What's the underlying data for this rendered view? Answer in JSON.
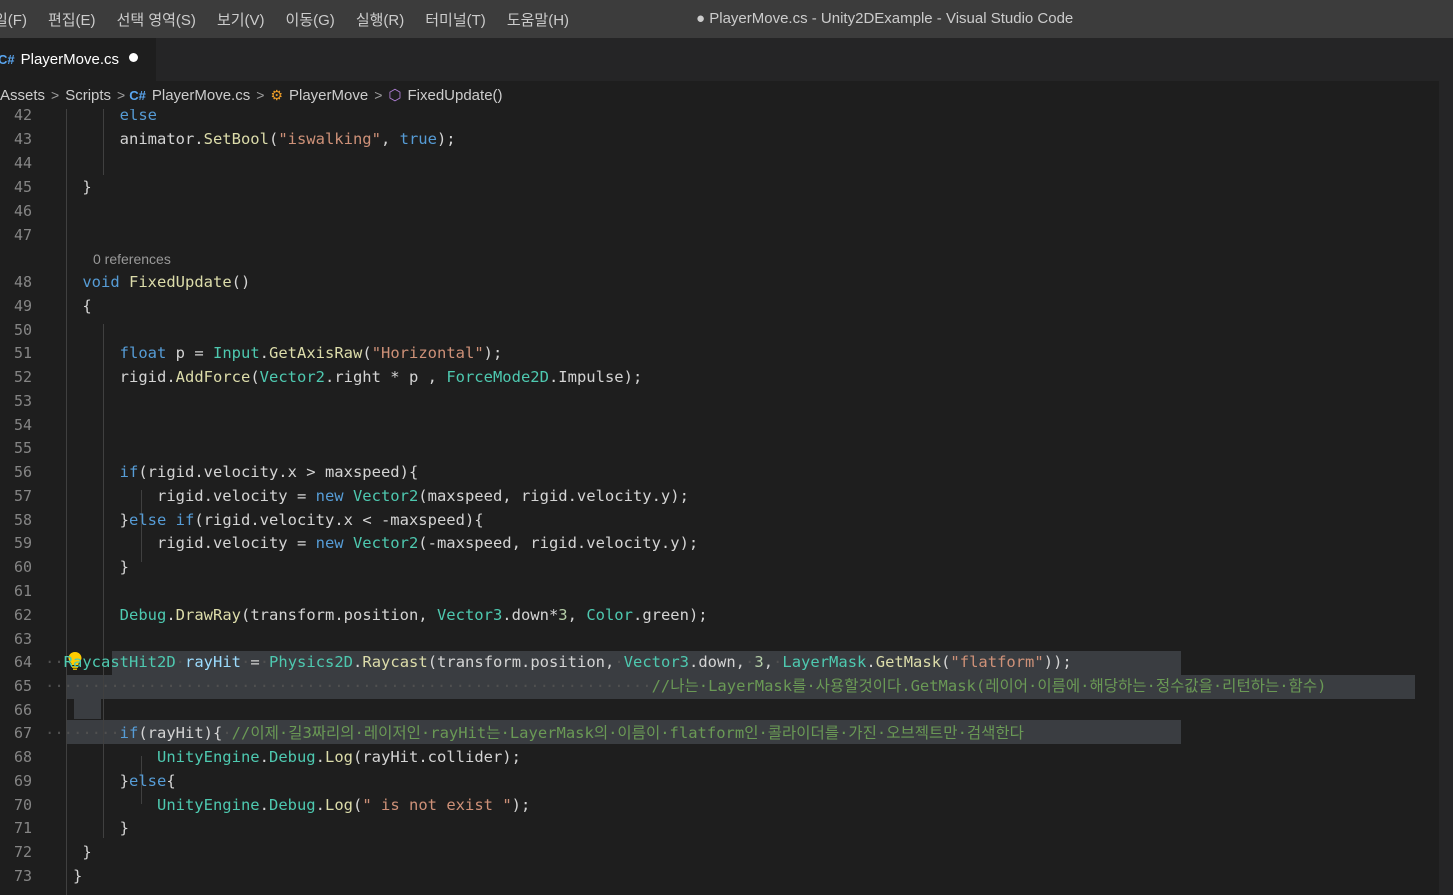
{
  "menu": [
    "일(F)",
    "편집(E)",
    "선택 영역(S)",
    "보기(V)",
    "이동(G)",
    "실행(R)",
    "터미널(T)",
    "도움말(H)"
  ],
  "window_title": "● PlayerMove.cs - Unity2DExample - Visual Studio Code",
  "tab": {
    "icon": "csharp-file-icon",
    "label": "PlayerMove.cs",
    "dirty": true
  },
  "breadcrumb": {
    "assets": "Assets",
    "scripts": "Scripts",
    "file": "PlayerMove.cs",
    "class": "PlayerMove",
    "method": "FixedUpdate()"
  },
  "codelens": "0 references",
  "colors": {
    "keyword": "#569cd6",
    "type": "#4ec9b0",
    "function": "#dcdcaa",
    "string": "#ce9178",
    "comment": "#6a9955",
    "selection": "#3a3d41",
    "background": "#1e1e1e"
  },
  "line_numbers": [
    "42",
    "43",
    "44",
    "45",
    "46",
    "47",
    "48",
    "49",
    "50",
    "51",
    "52",
    "53",
    "54",
    "55",
    "56",
    "57",
    "58",
    "59",
    "60",
    "61",
    "62",
    "63",
    "64",
    "65",
    "66",
    "67",
    "68",
    "69",
    "70",
    "71",
    "72",
    "73"
  ],
  "code_lines": [
    [
      {
        "t": "        ",
        "c": ""
      },
      {
        "t": "else",
        "c": "kw"
      }
    ],
    [
      {
        "t": "        animator.",
        "c": ""
      },
      {
        "t": "SetBool",
        "c": "fn"
      },
      {
        "t": "(",
        "c": ""
      },
      {
        "t": "\"iswalking\"",
        "c": "st"
      },
      {
        "t": ", ",
        "c": ""
      },
      {
        "t": "true",
        "c": "kw"
      },
      {
        "t": ");",
        "c": ""
      }
    ],
    [],
    [
      {
        "t": "    }",
        "c": ""
      }
    ],
    [],
    [],
    [
      {
        "t": "    ",
        "c": ""
      },
      {
        "t": "void",
        "c": "kw"
      },
      {
        "t": " ",
        "c": ""
      },
      {
        "t": "FixedUpdate",
        "c": "fn"
      },
      {
        "t": "()",
        "c": ""
      }
    ],
    [
      {
        "t": "    {",
        "c": ""
      }
    ],
    [],
    [
      {
        "t": "        ",
        "c": ""
      },
      {
        "t": "float",
        "c": "kw"
      },
      {
        "t": " p = ",
        "c": ""
      },
      {
        "t": "Input",
        "c": "ty"
      },
      {
        "t": ".",
        "c": ""
      },
      {
        "t": "GetAxisRaw",
        "c": "fn"
      },
      {
        "t": "(",
        "c": ""
      },
      {
        "t": "\"Horizontal\"",
        "c": "st"
      },
      {
        "t": ");",
        "c": ""
      }
    ],
    [
      {
        "t": "        rigid.",
        "c": ""
      },
      {
        "t": "AddForce",
        "c": "fn"
      },
      {
        "t": "(",
        "c": ""
      },
      {
        "t": "Vector2",
        "c": "ty"
      },
      {
        "t": ".right * p , ",
        "c": ""
      },
      {
        "t": "ForceMode2D",
        "c": "ty"
      },
      {
        "t": ".Impulse);",
        "c": ""
      }
    ],
    [],
    [],
    [],
    [
      {
        "t": "        ",
        "c": ""
      },
      {
        "t": "if",
        "c": "kw"
      },
      {
        "t": "(rigid.velocity.x > maxspeed){",
        "c": ""
      }
    ],
    [
      {
        "t": "            rigid.velocity = ",
        "c": ""
      },
      {
        "t": "new",
        "c": "kw"
      },
      {
        "t": " ",
        "c": ""
      },
      {
        "t": "Vector2",
        "c": "ty"
      },
      {
        "t": "(maxspeed, rigid.velocity.y);",
        "c": ""
      }
    ],
    [
      {
        "t": "        }",
        "c": ""
      },
      {
        "t": "else",
        "c": "kw"
      },
      {
        "t": " ",
        "c": ""
      },
      {
        "t": "if",
        "c": "kw"
      },
      {
        "t": "(rigid.velocity.x < -maxspeed){",
        "c": ""
      }
    ],
    [
      {
        "t": "            rigid.velocity = ",
        "c": ""
      },
      {
        "t": "new",
        "c": "kw"
      },
      {
        "t": " ",
        "c": ""
      },
      {
        "t": "Vector2",
        "c": "ty"
      },
      {
        "t": "(-maxspeed, rigid.velocity.y);",
        "c": ""
      }
    ],
    [
      {
        "t": "        }",
        "c": ""
      }
    ],
    [],
    [
      {
        "t": "        ",
        "c": ""
      },
      {
        "t": "Debug",
        "c": "ty"
      },
      {
        "t": ".",
        "c": ""
      },
      {
        "t": "DrawRay",
        "c": "fn"
      },
      {
        "t": "(transform.position, ",
        "c": ""
      },
      {
        "t": "Vector3",
        "c": "ty"
      },
      {
        "t": ".down*",
        "c": ""
      },
      {
        "t": "3",
        "c": "nm"
      },
      {
        "t": ", ",
        "c": ""
      },
      {
        "t": "Color",
        "c": "ty"
      },
      {
        "t": ".green);",
        "c": ""
      }
    ],
    [],
    [
      {
        "t": "··",
        "c": "ws"
      },
      {
        "t": "RaycastHit2D",
        "c": "ty"
      },
      {
        "t": "·",
        "c": "ws"
      },
      {
        "t": "rayHit",
        "c": "vr"
      },
      {
        "t": "·",
        "c": "ws"
      },
      {
        "t": "=",
        "c": ""
      },
      {
        "t": "·",
        "c": "ws"
      },
      {
        "t": "Physics2D",
        "c": "ty"
      },
      {
        "t": ".",
        "c": ""
      },
      {
        "t": "Raycast",
        "c": "fn"
      },
      {
        "t": "(transform.position,",
        "c": ""
      },
      {
        "t": "·",
        "c": "ws"
      },
      {
        "t": "Vector3",
        "c": "ty"
      },
      {
        "t": ".down,",
        "c": ""
      },
      {
        "t": "·",
        "c": "ws"
      },
      {
        "t": "3",
        "c": "nm"
      },
      {
        "t": ",",
        "c": ""
      },
      {
        "t": "·",
        "c": "ws"
      },
      {
        "t": "LayerMask",
        "c": "ty"
      },
      {
        "t": ".",
        "c": ""
      },
      {
        "t": "GetMask",
        "c": "fn"
      },
      {
        "t": "(",
        "c": ""
      },
      {
        "t": "\"flatform\"",
        "c": "st"
      },
      {
        "t": "));",
        "c": ""
      }
    ],
    [
      {
        "t": "·································································",
        "c": "ws"
      },
      {
        "t": "//나는·LayerMask를·사용할것이다.GetMask(레이어·이름에·해당하는·정수값을·리턴하는·함수)",
        "c": "cm"
      }
    ],
    [],
    [
      {
        "t": "········",
        "c": "ws"
      },
      {
        "t": "if",
        "c": "kw"
      },
      {
        "t": "(rayHit){",
        "c": ""
      },
      {
        "t": "·",
        "c": "ws"
      },
      {
        "t": "//이제·길3짜리의·레이저인·rayHit는·LayerMask의·이름이·flatform인·콜라이더를·가진·오브젝트만·검색한다",
        "c": "cm"
      }
    ],
    [
      {
        "t": "            ",
        "c": ""
      },
      {
        "t": "UnityEngine",
        "c": "ty"
      },
      {
        "t": ".",
        "c": ""
      },
      {
        "t": "Debug",
        "c": "ty"
      },
      {
        "t": ".",
        "c": ""
      },
      {
        "t": "Log",
        "c": "fn"
      },
      {
        "t": "(rayHit.collider);",
        "c": ""
      }
    ],
    [
      {
        "t": "        }",
        "c": ""
      },
      {
        "t": "else",
        "c": "kw"
      },
      {
        "t": "{",
        "c": ""
      }
    ],
    [
      {
        "t": "            ",
        "c": ""
      },
      {
        "t": "UnityEngine",
        "c": "ty"
      },
      {
        "t": ".",
        "c": ""
      },
      {
        "t": "Debug",
        "c": "ty"
      },
      {
        "t": ".",
        "c": ""
      },
      {
        "t": "Log",
        "c": "fn"
      },
      {
        "t": "(",
        "c": ""
      },
      {
        "t": "\" is not exist \"",
        "c": "st"
      },
      {
        "t": ");",
        "c": ""
      }
    ],
    [
      {
        "t": "        }",
        "c": ""
      }
    ],
    [
      {
        "t": "    }",
        "c": ""
      }
    ],
    [
      {
        "t": "   }",
        "c": ""
      }
    ]
  ]
}
